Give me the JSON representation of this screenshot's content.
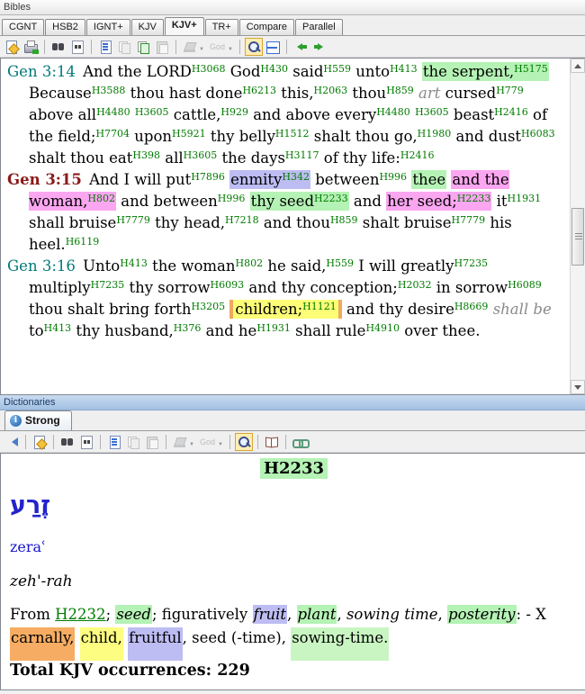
{
  "colors": {
    "strong_number": "#007b00",
    "verse_ref_teal": "#00797b",
    "verse_ref_maroon": "#8b1a1a",
    "hebrew_blue": "#2323cc",
    "link_green": "#007b00",
    "hl_green": "#b5f2b5",
    "hl_pink": "#fba6f1",
    "hl_lavender": "#bdbdf3",
    "hl_yellow": "#fdfd78",
    "hl_orange": "#f6ad63",
    "marker_orange": "#efa95f",
    "dict_titlebar": "#a2c0e2"
  },
  "bibles_panel": {
    "title": "Bibles",
    "tabs": [
      {
        "label": "CGNT",
        "active": false
      },
      {
        "label": "HSB2",
        "active": false
      },
      {
        "label": "IGNT+",
        "active": false
      },
      {
        "label": "KJV",
        "active": false
      },
      {
        "label": "KJV+",
        "active": true
      },
      {
        "label": "TR+",
        "active": false
      },
      {
        "label": "Compare",
        "active": false
      },
      {
        "label": "Parallel",
        "active": false
      }
    ],
    "toolbar": [
      {
        "name": "open-note-icon"
      },
      {
        "name": "print-icon"
      },
      {
        "name": "separator"
      },
      {
        "name": "search-icon"
      },
      {
        "name": "search-page-icon"
      },
      {
        "name": "separator"
      },
      {
        "name": "document-icon"
      },
      {
        "name": "copy-icon",
        "disabled": true
      },
      {
        "name": "copy-add-icon"
      },
      {
        "name": "paste-icon",
        "disabled": true
      },
      {
        "name": "separator"
      },
      {
        "name": "highlighter-icon",
        "dropdown": true,
        "disabled": true
      },
      {
        "name": "god-word-label",
        "text": "God",
        "dropdown": true,
        "disabled": true
      },
      {
        "name": "separator"
      },
      {
        "name": "zoom-icon",
        "active": true
      },
      {
        "name": "split-view-icon"
      },
      {
        "name": "separator"
      },
      {
        "name": "back-arrow-icon"
      },
      {
        "name": "forward-arrow-icon"
      }
    ],
    "verses": [
      {
        "ref": "Gen 3:14",
        "ref_class": "teal",
        "tokens": [
          {
            "t": "And the LORD"
          },
          {
            "s": "H3068"
          },
          {
            "t": " God"
          },
          {
            "s": "H430"
          },
          {
            "t": " said"
          },
          {
            "s": "H559"
          },
          {
            "t": " unto"
          },
          {
            "s": "H413"
          },
          {
            "t": " "
          },
          {
            "hl": "green",
            "parts": [
              {
                "t": "the serpent,"
              },
              {
                "s": "H5175"
              }
            ]
          },
          {
            "t": " Because"
          },
          {
            "s": "H3588"
          },
          {
            "t": " thou hast done"
          },
          {
            "s": "H6213"
          },
          {
            "t": " this,"
          },
          {
            "s": "H2063"
          },
          {
            "t": " thou"
          },
          {
            "s": "H859"
          },
          {
            "t": " "
          },
          {
            "t": "art",
            "style": "added"
          },
          {
            "t": " cursed"
          },
          {
            "s": "H779"
          },
          {
            "t": " above all"
          },
          {
            "s": "H4480"
          },
          {
            "t": " "
          },
          {
            "s": "H3605"
          },
          {
            "t": " cattle,"
          },
          {
            "s": "H929"
          },
          {
            "t": " and above every"
          },
          {
            "s": "H4480"
          },
          {
            "t": " "
          },
          {
            "s": "H3605"
          },
          {
            "t": " beast"
          },
          {
            "s": "H2416"
          },
          {
            "t": " of the field;"
          },
          {
            "s": "H7704"
          },
          {
            "t": " upon"
          },
          {
            "s": "H5921"
          },
          {
            "t": " thy belly"
          },
          {
            "s": "H1512"
          },
          {
            "t": " shalt thou go,"
          },
          {
            "s": "H1980"
          },
          {
            "t": " and dust"
          },
          {
            "s": "H6083"
          },
          {
            "t": " shalt thou eat"
          },
          {
            "s": "H398"
          },
          {
            "t": " all"
          },
          {
            "s": "H3605"
          },
          {
            "t": " the days"
          },
          {
            "s": "H3117"
          },
          {
            "t": " of thy life:"
          },
          {
            "s": "H2416"
          }
        ]
      },
      {
        "ref": "Gen 3:15",
        "ref_class": "maroon",
        "tokens": [
          {
            "t": "And I will put"
          },
          {
            "s": "H7896"
          },
          {
            "t": " "
          },
          {
            "hl": "lavender",
            "parts": [
              {
                "t": "enmity"
              },
              {
                "s": "H342"
              }
            ]
          },
          {
            "t": " between"
          },
          {
            "s": "H996"
          },
          {
            "t": " "
          },
          {
            "hl": "green",
            "parts": [
              {
                "t": "thee"
              }
            ]
          },
          {
            "t": " "
          },
          {
            "hl": "pink",
            "parts": [
              {
                "t": "and the woman,"
              },
              {
                "s": "H802"
              }
            ]
          },
          {
            "t": " and between"
          },
          {
            "s": "H996"
          },
          {
            "t": " "
          },
          {
            "hl": "green",
            "parts": [
              {
                "t": "thy seed"
              },
              {
                "s": "H2233"
              }
            ]
          },
          {
            "t": " and "
          },
          {
            "hl": "pink",
            "parts": [
              {
                "t": "her seed;"
              },
              {
                "s": "H2233"
              }
            ]
          },
          {
            "t": " it"
          },
          {
            "s": "H1931"
          },
          {
            "t": " shall bruise"
          },
          {
            "s": "H7779"
          },
          {
            "t": " thy head,"
          },
          {
            "s": "H7218"
          },
          {
            "t": " and thou"
          },
          {
            "s": "H859"
          },
          {
            "t": " shalt bruise"
          },
          {
            "s": "H7779"
          },
          {
            "t": " his heel."
          },
          {
            "s": "H6119"
          }
        ]
      },
      {
        "ref": "Gen 3:16",
        "ref_class": "teal",
        "tokens": [
          {
            "t": "Unto"
          },
          {
            "s": "H413"
          },
          {
            "t": " the woman"
          },
          {
            "s": "H802"
          },
          {
            "t": " he said,"
          },
          {
            "s": "H559"
          },
          {
            "t": " I will greatly"
          },
          {
            "s": "H7235"
          },
          {
            "t": " multiply"
          },
          {
            "s": "H7235"
          },
          {
            "t": " thy sorrow"
          },
          {
            "s": "H6093"
          },
          {
            "t": " and thy conception;"
          },
          {
            "s": "H2032"
          },
          {
            "t": " in sorrow"
          },
          {
            "s": "H6089"
          },
          {
            "t": " thou shalt bring forth"
          },
          {
            "s": "H3205"
          },
          {
            "t": " "
          },
          {
            "hl": "yellow-marked",
            "parts": [
              {
                "t": "children;"
              },
              {
                "s": "H1121"
              }
            ]
          },
          {
            "t": " and thy desire"
          },
          {
            "s": "H8669"
          },
          {
            "t": " "
          },
          {
            "t": "shall be",
            "style": "added"
          },
          {
            "t": " to"
          },
          {
            "s": "H413"
          },
          {
            "t": " thy husband,"
          },
          {
            "s": "H376"
          },
          {
            "t": " and he"
          },
          {
            "s": "H1931"
          },
          {
            "t": " shall rule"
          },
          {
            "s": "H4910"
          },
          {
            "t": " over thee."
          }
        ]
      }
    ]
  },
  "dictionaries_panel": {
    "title": "Dictionaries",
    "tab": {
      "label": "Strong"
    },
    "toolbar": [
      {
        "name": "back-arrow-blue-icon"
      },
      {
        "name": "separator"
      },
      {
        "name": "open-note-icon"
      },
      {
        "name": "separator"
      },
      {
        "name": "search-icon"
      },
      {
        "name": "search-page-icon"
      },
      {
        "name": "separator"
      },
      {
        "name": "document-icon"
      },
      {
        "name": "copy-icon",
        "disabled": true
      },
      {
        "name": "paste-icon",
        "disabled": true
      },
      {
        "name": "separator"
      },
      {
        "name": "highlighter-icon",
        "dropdown": true,
        "disabled": true
      },
      {
        "name": "god-word-label",
        "text": "God",
        "dropdown": true,
        "disabled": true
      },
      {
        "name": "separator"
      },
      {
        "name": "zoom-icon",
        "active": true
      },
      {
        "name": "separator"
      },
      {
        "name": "book-icon"
      },
      {
        "name": "separator"
      },
      {
        "name": "link-icon"
      }
    ],
    "entry": {
      "headword": "H2233",
      "hebrew": "זֶרַע",
      "transliteration": "zeraʿ",
      "pronunciation": "zeh'-rah",
      "definition_tokens": [
        {
          "t": "From "
        },
        {
          "t": "H2232",
          "style": "link"
        },
        {
          "t": "; "
        },
        {
          "hl": "green",
          "parts": [
            {
              "t": "seed",
              "style": "it"
            }
          ]
        },
        {
          "t": "; figuratively "
        },
        {
          "hl": "lavender",
          "parts": [
            {
              "t": "fruit",
              "style": "it"
            }
          ]
        },
        {
          "t": ", "
        },
        {
          "hl": "green",
          "parts": [
            {
              "t": "plant",
              "style": "it"
            }
          ]
        },
        {
          "t": ", "
        },
        {
          "t": "sowing time",
          "style": "it"
        },
        {
          "t": ", "
        },
        {
          "hl": "green",
          "parts": [
            {
              "t": "posterity",
              "style": "it"
            }
          ]
        },
        {
          "t": ": - X "
        },
        {
          "hl": "orange-tall",
          "parts": [
            {
              "t": "carnally,"
            }
          ]
        },
        {
          "t": " "
        },
        {
          "hl": "yellow-tall",
          "parts": [
            {
              "t": "child,"
            }
          ]
        },
        {
          "t": " "
        },
        {
          "hl": "lavender-tall",
          "parts": [
            {
              "t": "fruitful"
            }
          ]
        },
        {
          "t": ", seed (-time), "
        },
        {
          "hl": "green-tall",
          "parts": [
            {
              "t": "sowing-time."
            }
          ]
        }
      ],
      "total_label": "Total KJV occurrences:",
      "total_value": "229"
    }
  }
}
